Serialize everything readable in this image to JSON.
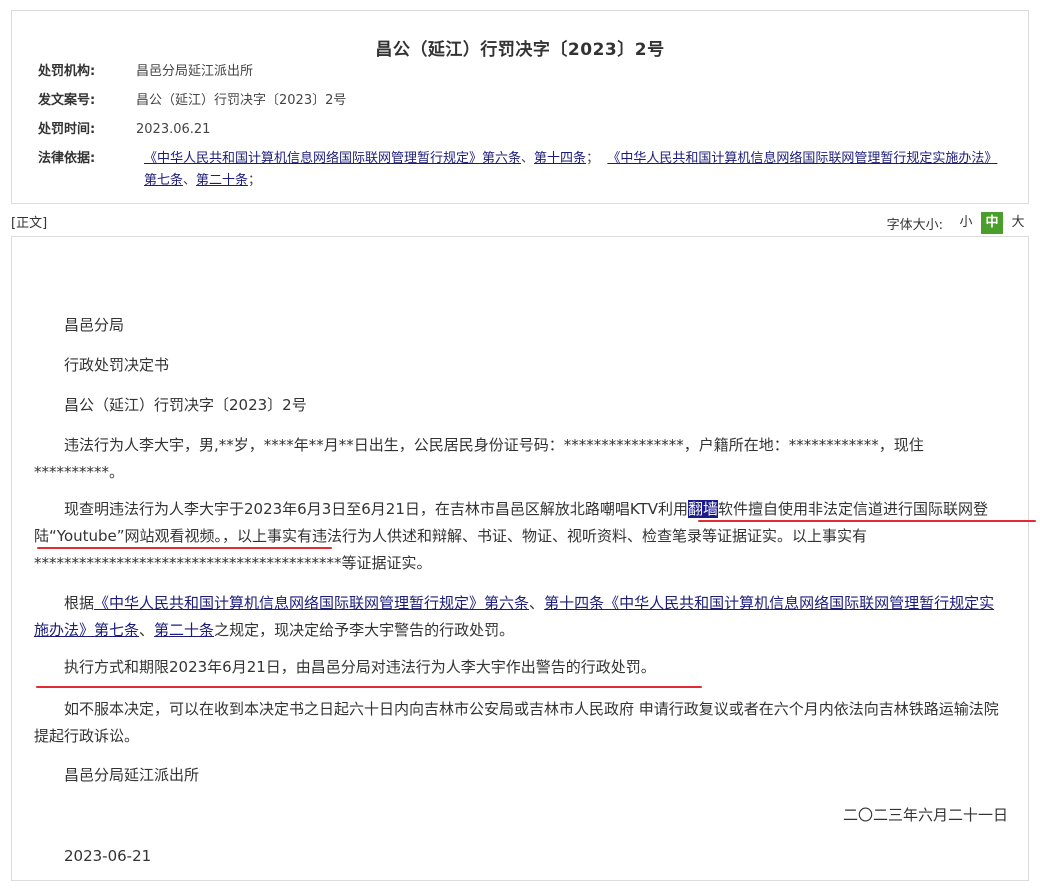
{
  "header": {
    "title": "昌公（延江）行罚决字〔2023〕2号",
    "rows": [
      {
        "label": "处罚机构:",
        "value": "昌邑分局延江派出所"
      },
      {
        "label": "发文案号:",
        "value": "昌公（延江）行罚决字〔2023〕2号"
      },
      {
        "label": "处罚时间:",
        "value": "2023.06.21"
      }
    ],
    "legal_basis": {
      "label": "法律依据:",
      "link1": "《中华人民共和国计算机信息网络国际联网管理暂行规定》",
      "art1": "第六条",
      "sep1": "、",
      "art2": "第十四条",
      "sep2": "；",
      "link2": "《中华人民共和国计算机信息网络国际联网管理暂行规定实施办法》",
      "art3": "第七条",
      "sep3": "、",
      "art4": "第二十条",
      "sep4": "；"
    }
  },
  "zhengwen_label": "[正文]",
  "font_size": {
    "label": "字体大小:",
    "small": "小",
    "medium": "中",
    "large": "大"
  },
  "body": {
    "p1": "昌邑分局",
    "p2": "行政处罚决定书",
    "p3": "昌公（延江）行罚决字〔2023〕2号",
    "p4": "违法行为人李大宇，男,**岁，****年**月**日出生，公民居民身份证号码：****************，户籍所在地：************，现住**********。",
    "p5a": "现查明违法行为人李大宇于2023年6月3日至6月21日，在吉林市昌邑区解放北路嘲唱KTV利用",
    "p5hl": "翻墙",
    "p5b": "软件擅自使用非法定信道进行国际联网登陆“Youtube”网站观看视频。，以上事实有违法行为人供述和辩解、书证、物证、视听资料、检查笔录等证据证实。以上事实有*****************************************等证据证实。",
    "p6a": "根据",
    "p6link1": "《中华人民共和国计算机信息网络国际联网管理暂行规定》",
    "p6art1": "第六条",
    "p6sep1": "、",
    "p6art2": "第十四条",
    "p6link2": "《中华人民共和国计算机信息网络国际联网管理暂行规定实施办法》",
    "p6art3": "第七条",
    "p6sep2": "、",
    "p6art4": "第二十条",
    "p6b": "之规定，现决定给予李大宇警告的行政处罚。",
    "p7": "执行方式和期限2023年6月21日，由昌邑分局对违法行为人李大宇作出警告的行政处罚。",
    "p8": "如不服本决定，可以在收到本决定书之日起六十日内向吉林市公安局或吉林市人民政府 申请行政复议或者在六个月内依法向吉林铁路运输法院 提起行政诉讼。",
    "p9": "昌邑分局延江派出所",
    "p10": "二〇二三年六月二十一日",
    "p11": "2023-06-21"
  },
  "colors": {
    "highlight": "#1a1a8c",
    "underline_red": "#e22b34",
    "active_green": "#4a9e2b",
    "link_blue": "#1c1c7a"
  }
}
